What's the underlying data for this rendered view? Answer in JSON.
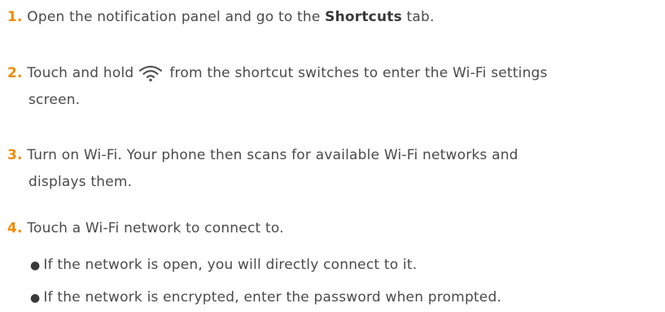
{
  "steps": [
    {
      "number": "1.",
      "text_before": "Open the notification panel and go to the ",
      "bold": "Shortcuts",
      "text_after": " tab."
    },
    {
      "number": "2.",
      "text_before": "Touch and hold",
      "icon": "wifi-icon",
      "text_after": "from the shortcut switches to enter the Wi-Fi settings",
      "continuation": "screen."
    },
    {
      "number": "3.",
      "text": "Turn on Wi-Fi. Your phone then scans for available Wi-Fi networks and",
      "continuation": "displays them."
    },
    {
      "number": "4.",
      "text": "Touch a Wi-Fi network to connect to."
    }
  ],
  "bullets": [
    "If the network is open, you will directly connect to it.",
    "If the network is encrypted, enter the password when prompted."
  ],
  "colors": {
    "step_number": "#f08c00",
    "body_text": "#4a4a4a"
  }
}
